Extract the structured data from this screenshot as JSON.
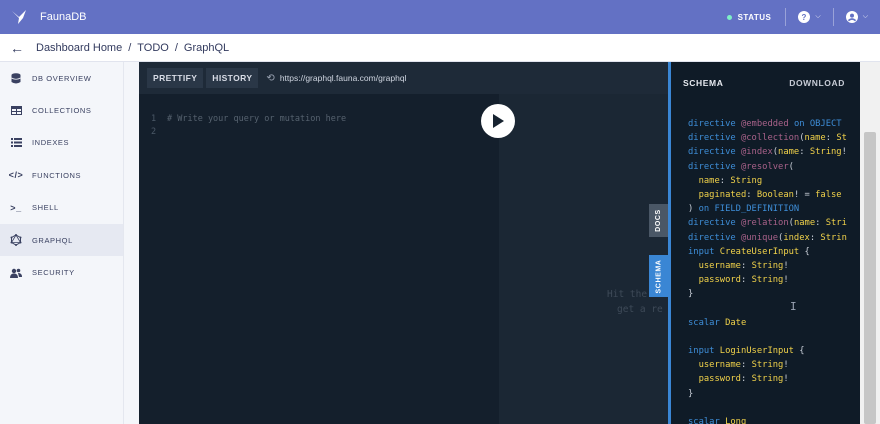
{
  "app": {
    "title": "FaunaDB"
  },
  "topbar": {
    "status_label": "STATUS",
    "status_color": "#7ef0c6",
    "help_icon": "question-circle-icon",
    "account_icon": "user-circle-icon"
  },
  "breadcrumb": {
    "items": [
      "Dashboard Home",
      "TODO",
      "GraphQL"
    ],
    "separator": "/"
  },
  "sidebar": {
    "items": [
      {
        "label": "DB OVERVIEW",
        "icon": "database-icon"
      },
      {
        "label": "COLLECTIONS",
        "icon": "table-icon"
      },
      {
        "label": "INDEXES",
        "icon": "list-icon"
      },
      {
        "label": "FUNCTIONS",
        "icon": "code-icon"
      },
      {
        "label": "SHELL",
        "icon": "terminal-icon"
      },
      {
        "label": "GRAPHQL",
        "icon": "graphql-icon",
        "active": true
      },
      {
        "label": "SECURITY",
        "icon": "users-icon"
      }
    ]
  },
  "toolbar": {
    "prettify_label": "PRETTIFY",
    "history_label": "HISTORY",
    "endpoint_url": "https://graphql.fauna.com/graphql"
  },
  "editor": {
    "lines": [
      {
        "num": "1",
        "text": "# Write your query or mutation here"
      },
      {
        "num": "2",
        "text": ""
      }
    ],
    "result_hint_line1": "Hit the",
    "result_hint_line2": "get a re"
  },
  "side_tabs": {
    "docs": "DOCS",
    "schema": "SCHEMA"
  },
  "schema_panel": {
    "title": "SCHEMA",
    "download_label": "DOWNLOAD",
    "lines": [
      "directive @embedded on OBJECT",
      "directive @collection(name: St",
      "directive @index(name: String!",
      "directive @resolver(",
      "  name: String",
      "  paginated: Boolean! = false",
      ") on FIELD_DEFINITION",
      "directive @relation(name: Stri",
      "directive @unique(index: Strin",
      "input CreateUserInput {",
      "  username: String!",
      "  password: String!",
      "}",
      "",
      "scalar Date",
      "",
      "input LoginUserInput {",
      "  username: String!",
      "  password: String!",
      "}",
      "",
      "scalar Long"
    ]
  },
  "colors": {
    "topbar": "#6371c4",
    "accent": "#3a86d4",
    "editor_bg": "#141f2c",
    "schema_bg": "#0f1b27"
  }
}
